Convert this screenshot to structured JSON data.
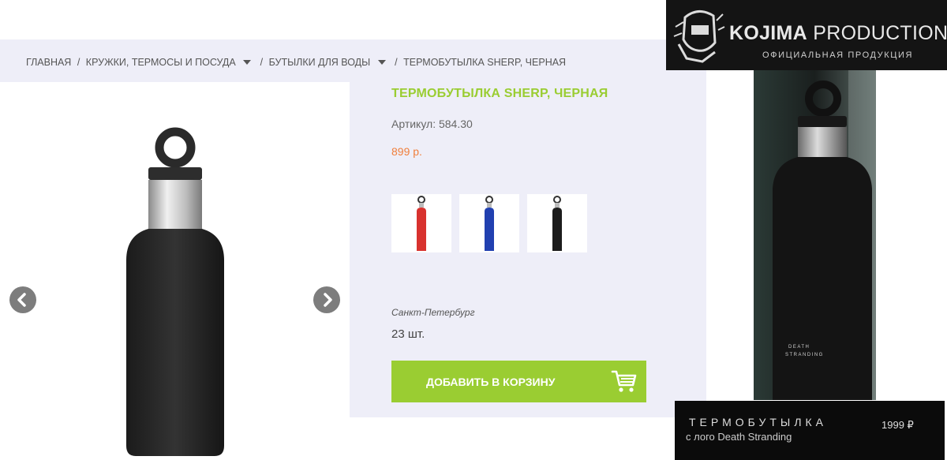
{
  "breadcrumb": {
    "items": [
      {
        "label": "Главная",
        "dropdown": false
      },
      {
        "label": "Кружки, термосы и посуда",
        "dropdown": true
      },
      {
        "label": "Бутылки для воды",
        "dropdown": true
      },
      {
        "label": "Термобутылка Sherp, черная",
        "dropdown": false
      }
    ],
    "separator": "/"
  },
  "product": {
    "title": "ТЕРМОБУТЫЛКА SHERP, ЧЕРНАЯ",
    "sku": "Артикул: 584.30",
    "price": "899 р.",
    "color_variants": [
      {
        "name": "red",
        "color": "#d8322e"
      },
      {
        "name": "blue",
        "color": "#2140b0"
      },
      {
        "name": "black",
        "color": "#1c1c1c"
      }
    ],
    "city": "Санкт-Петербург",
    "stock": "23 шт.",
    "add_to_cart_label": "ДОБАВИТЬ В КОРЗИНУ"
  },
  "gallery": {
    "prev_icon": "chevron-left-icon",
    "next_icon": "chevron-right-icon"
  },
  "collage": {
    "brand_name_prefix": "KOJIMA",
    "brand_name_suffix": "PRODUCTIONS",
    "brand_subtitle": "ОФИЦИАЛЬНАЯ ПРОДУКЦИЯ",
    "bottle_print_line1": "DEATH",
    "bottle_print_line2": "STRANDING",
    "tag_title": "ТЕРМОБУТЫЛКА",
    "tag_subtitle": "с лого Death Stranding",
    "tag_price": "1999 ₽"
  },
  "colors": {
    "accent_green": "#9acd32",
    "price_orange": "#f07f3c",
    "panel_bg": "#eeeef8"
  }
}
